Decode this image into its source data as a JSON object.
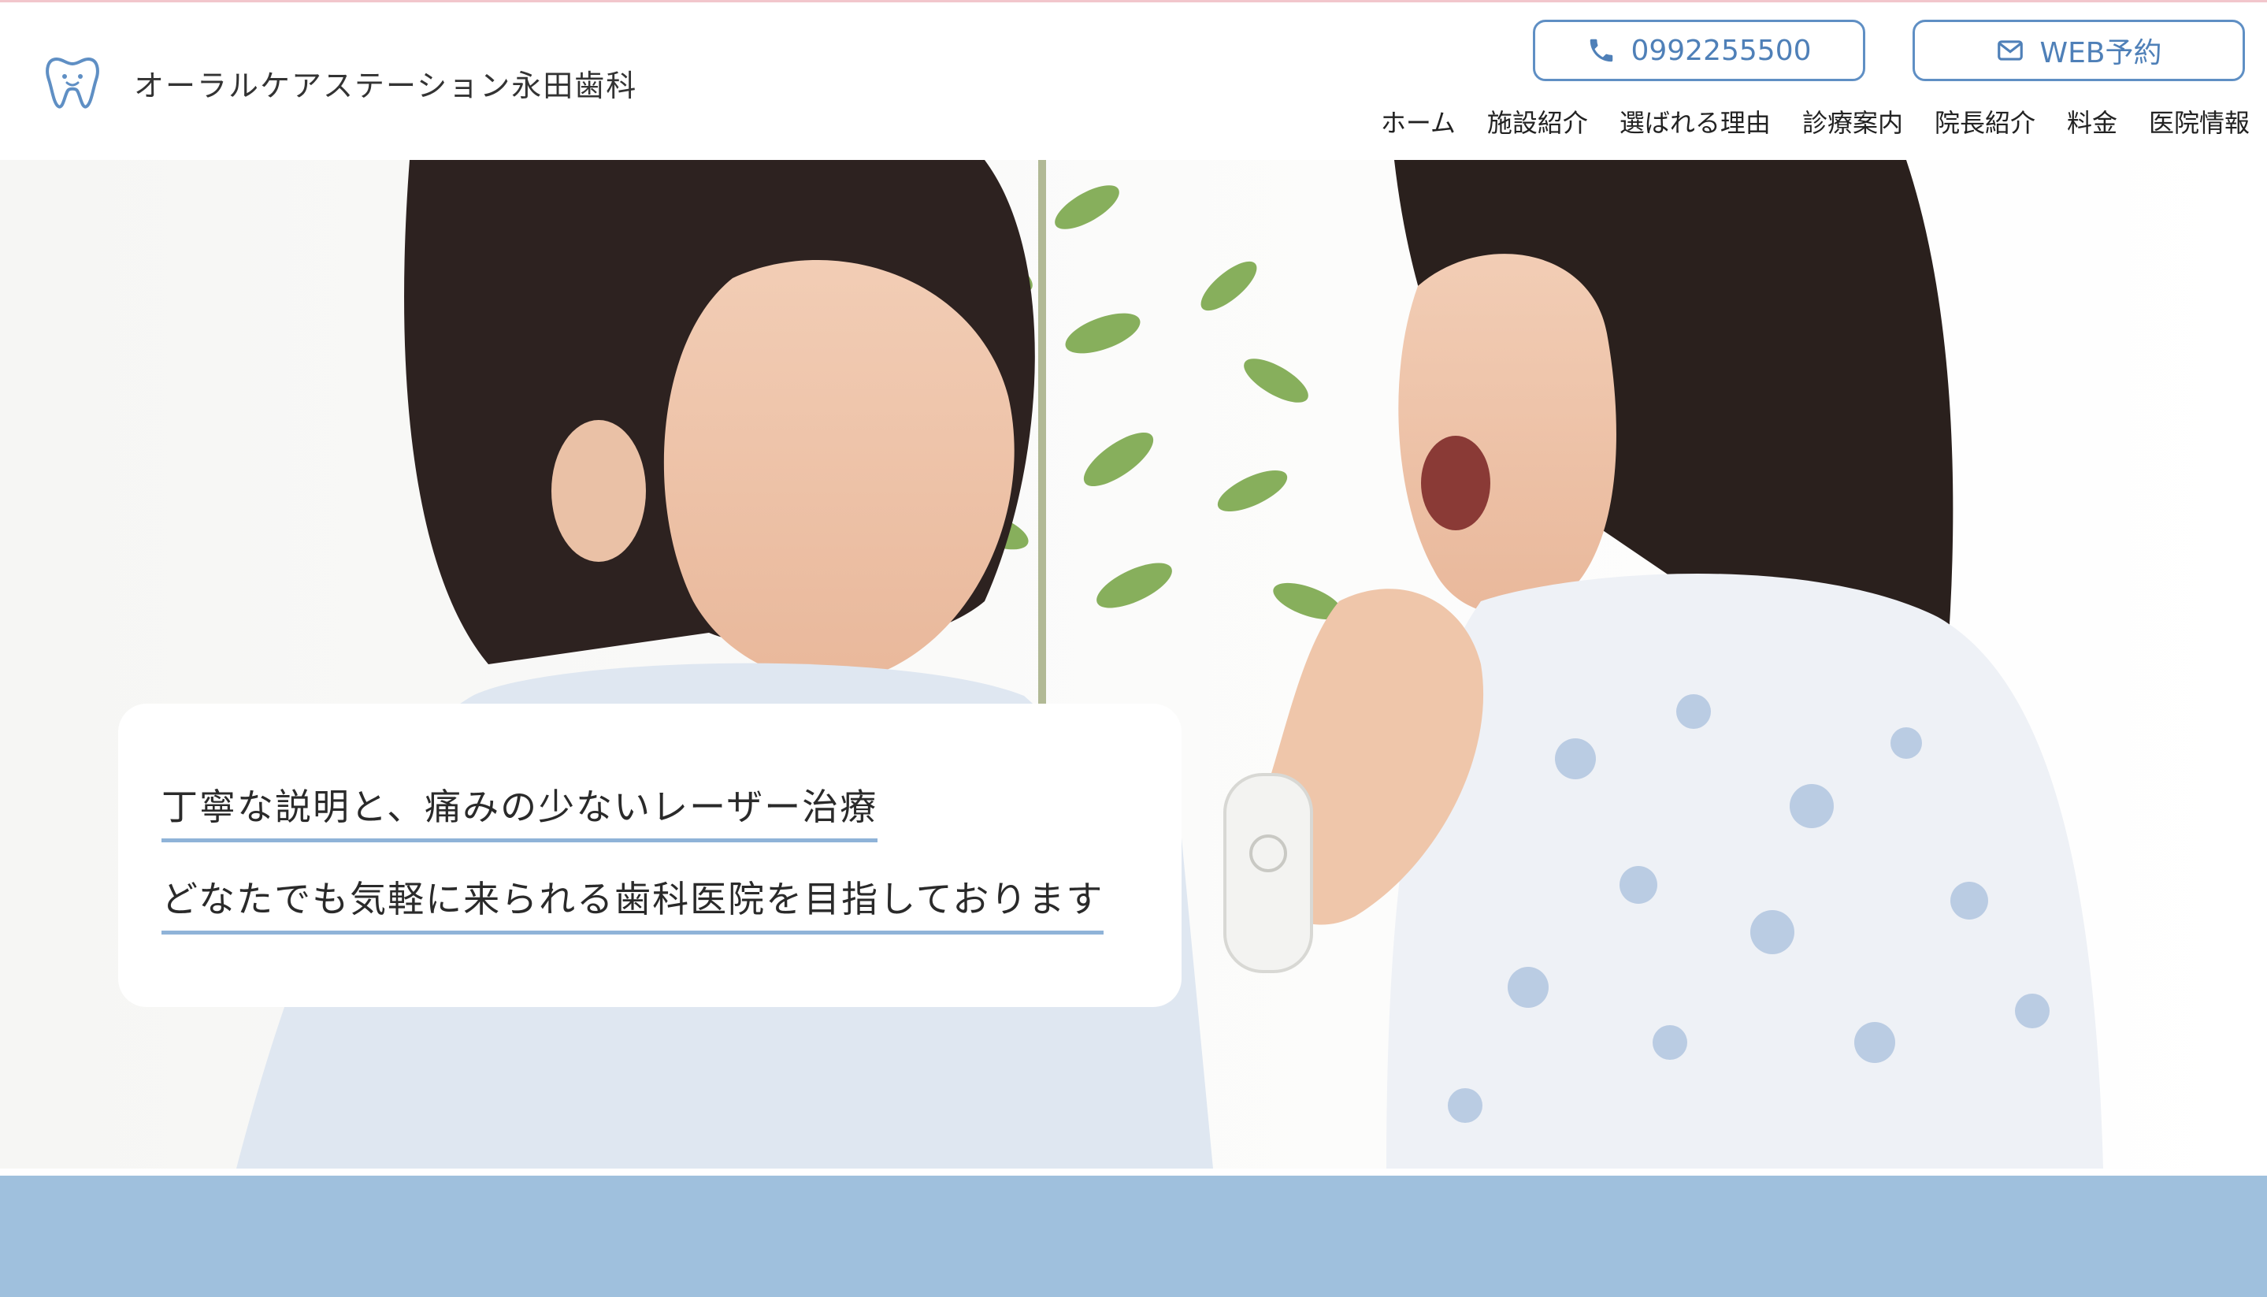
{
  "header": {
    "clinic_name": "オーラルケアステーション永田歯科",
    "phone_label": "0992255500",
    "web_booking_label": "WEB予約"
  },
  "nav": {
    "items": [
      {
        "label": "ホーム"
      },
      {
        "label": "施設紹介"
      },
      {
        "label": "選ばれる理由"
      },
      {
        "label": "診療案内"
      },
      {
        "label": "院長紹介"
      },
      {
        "label": "料金"
      },
      {
        "label": "医院情報"
      }
    ]
  },
  "hero": {
    "tagline_1": "丁寧な説明と、痛みの少ないレーザー治療",
    "tagline_2": "どなたでも気軽に来られる歯科医院を目指しております"
  },
  "icons": {
    "logo": "tooth-icon",
    "phone": "phone-icon",
    "mail": "mail-icon"
  },
  "colors": {
    "accent": "#5f8fc4",
    "band": "#9fc0dd",
    "underline": "#8fb3d8",
    "top_line": "#f2c6cc"
  }
}
